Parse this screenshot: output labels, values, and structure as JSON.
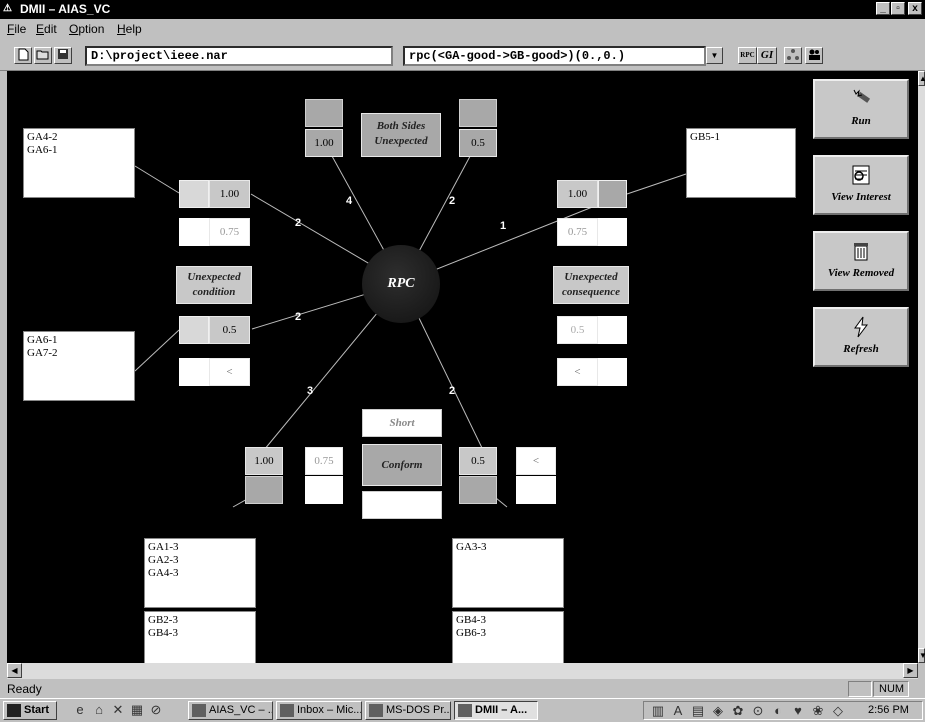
{
  "window": {
    "title": "DMII – AIAS_VC",
    "min_glyph": "_",
    "max_glyph": "▫",
    "close_glyph": "x"
  },
  "menu": {
    "items": [
      {
        "label": "File",
        "first": "F",
        "rest": "ile"
      },
      {
        "label": "Edit",
        "first": "E",
        "rest": "dit"
      },
      {
        "label": "Option",
        "first": "O",
        "rest": "ption"
      },
      {
        "label": "Help",
        "first": "H",
        "rest": "elp"
      }
    ]
  },
  "toolbar": {
    "path_value": "D:\\project\\ieee.nar",
    "rule_value": "rpc(<GA-good->GB-good>)(0.,0.)",
    "rpc_label": "RPC",
    "gi_label": "GI"
  },
  "diagram": {
    "center_label": "RPC",
    "top": {
      "label_line1": "Both Sides",
      "label_line2": "Unexpected",
      "left_value": "1.00",
      "right_value": "0.5"
    },
    "upper_left": {
      "items": [
        "GA4-2",
        "GA6-1"
      ],
      "value": "1.00",
      "value2": "0.75"
    },
    "upper_right": {
      "items": [
        "GB5-1"
      ],
      "value": "1.00",
      "value2": "0.75"
    },
    "left_label": {
      "line1": "Unexpected",
      "line2": "condition"
    },
    "right_label": {
      "line1": "Unexpected",
      "line2": "consequence"
    },
    "lower_left": {
      "items": [
        "GA6-1",
        "GA7-2"
      ],
      "value": "0.5",
      "value2": "<"
    },
    "lower_right_mid": {
      "value": "0.5",
      "value2": "<"
    },
    "bottom": {
      "short_label": "Short",
      "conform_label": "Conform",
      "left_value": "1.00",
      "left_value2": "0.75",
      "right_value": "0.5",
      "right_value2": "<",
      "left_items_a": [
        "GA1-3",
        "GA2-3",
        "GA4-3"
      ],
      "left_items_b": [
        "GB2-3",
        "GB4-3"
      ],
      "right_items_a": [
        "GA3-3"
      ],
      "right_items_b": [
        "GB4-3",
        "GB6-3"
      ]
    },
    "edge_counts": {
      "top_left": "4",
      "top_right": "2",
      "upper_left": "2",
      "upper_right": "1",
      "left": "2",
      "bottom_left": "3",
      "bottom_right": "2"
    }
  },
  "side_buttons": {
    "run": "Run",
    "view_interest": "View Interest",
    "view_removed": "View Removed",
    "refresh": "Refresh"
  },
  "status": {
    "text": "Ready",
    "num": "NUM"
  },
  "taskbar": {
    "start": "Start",
    "tasks": [
      "AIAS_VC – ...",
      "Inbox – Mic...",
      "MS-DOS Pr...",
      "DMII – A..."
    ],
    "clock": "2:56 PM"
  },
  "colors": {
    "canvas": "#000000",
    "chrome": "#c0c0c0",
    "center_node": "#1a1a1a"
  }
}
